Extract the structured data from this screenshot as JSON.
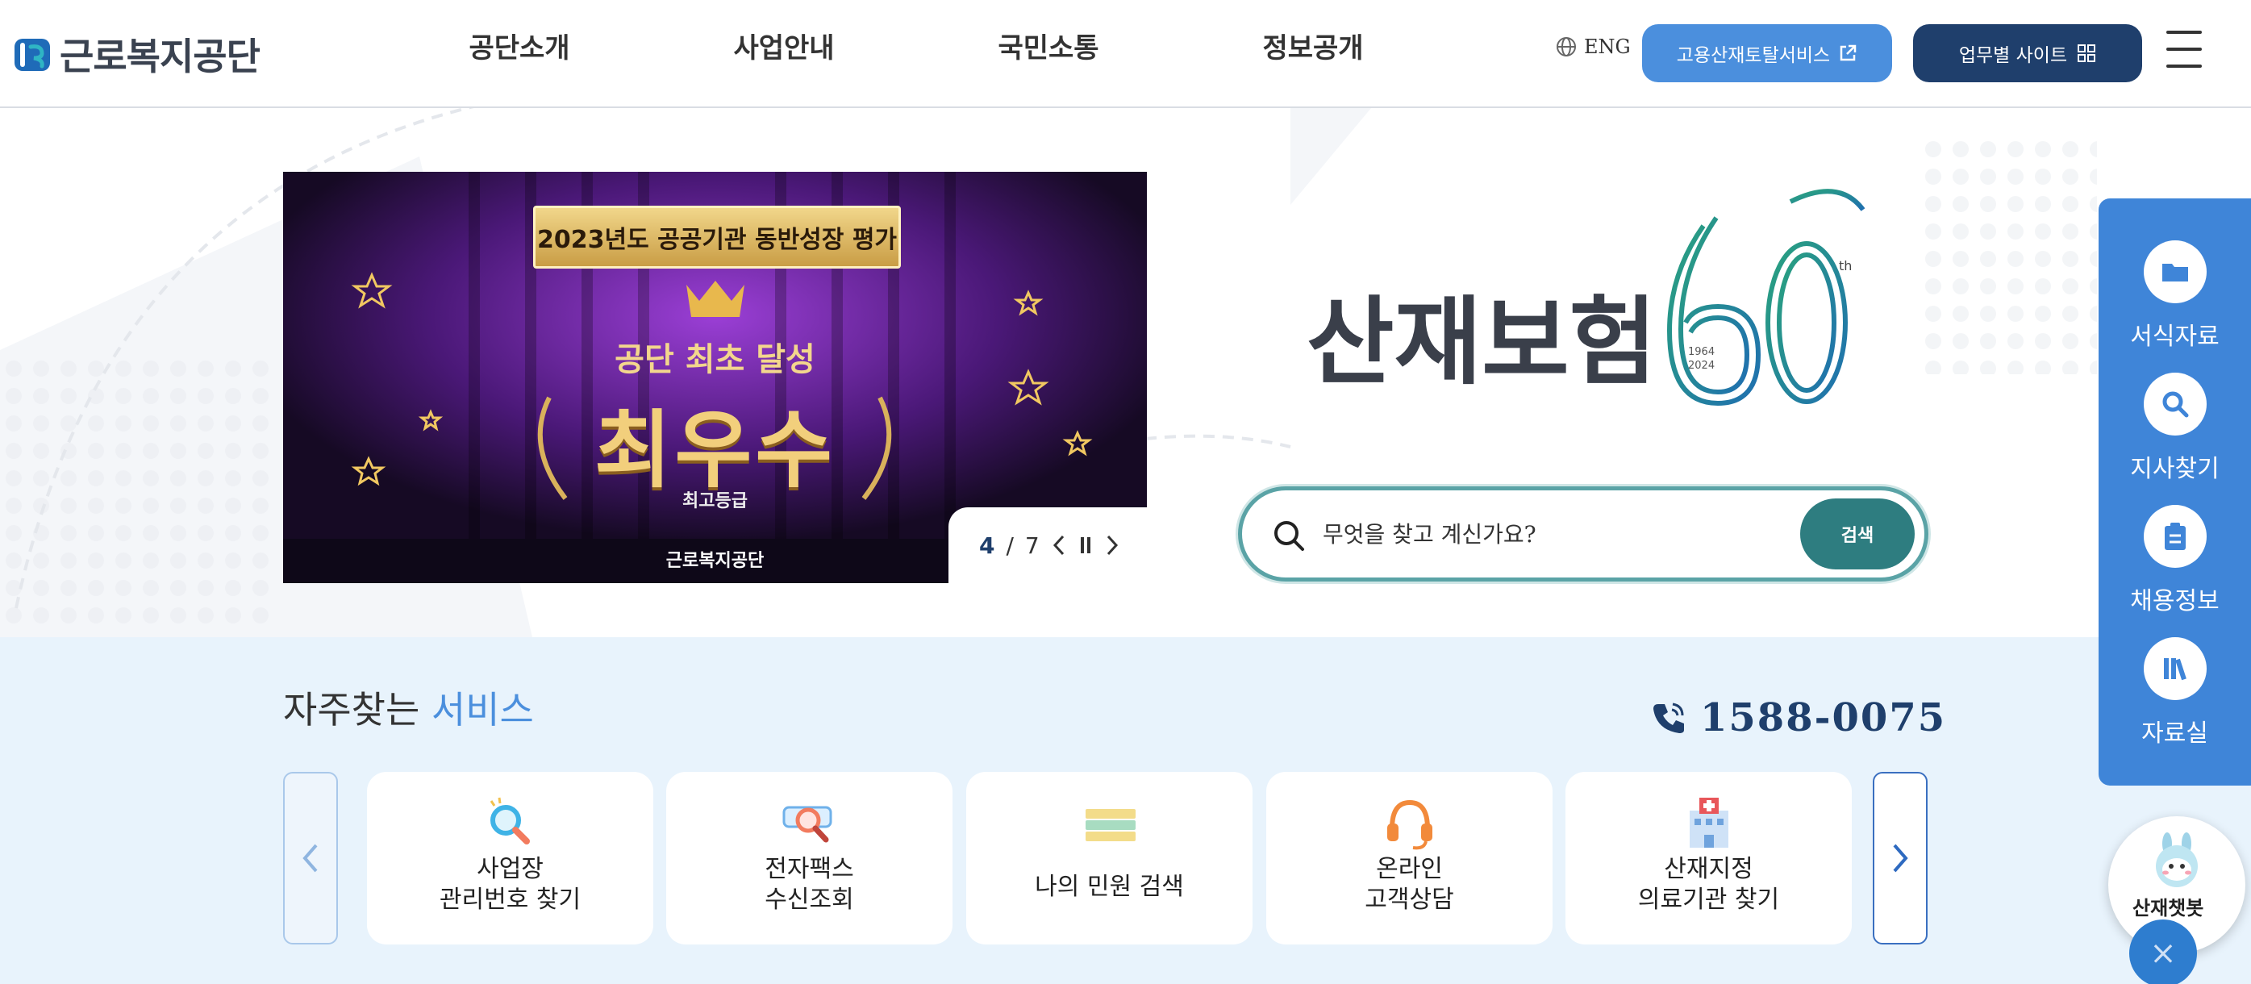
{
  "header": {
    "logo_text": "근로복지공단",
    "nav": [
      "공단소개",
      "사업안내",
      "국민소통",
      "정보공개"
    ],
    "lang_label": "ENG",
    "portal_button": "고용산재토탈서비스",
    "sites_button": "업무별 사이트"
  },
  "hero": {
    "banner": {
      "badge": "2023년도 공공기관 동반성장 평가",
      "subtitle": "공단 최초 달성",
      "main": "최우수",
      "grade": "최고등급",
      "org": "근로복지공단"
    },
    "pager": {
      "current": "4",
      "separator": "/",
      "total": "7"
    },
    "anniversary": {
      "text": "산재보험",
      "number": "60",
      "suffix": "th",
      "years_top": "1964",
      "years_bottom": "2024"
    },
    "search": {
      "placeholder": "무엇을 찾고 계신가요?",
      "button": "검색"
    }
  },
  "quick_menu": {
    "items": [
      {
        "label": "서식자료",
        "icon": "folder-icon"
      },
      {
        "label": "지사찾기",
        "icon": "search-icon"
      },
      {
        "label": "채용정보",
        "icon": "document-icon"
      },
      {
        "label": "자료실",
        "icon": "books-icon"
      }
    ]
  },
  "chatbot": {
    "label": "산재챗봇",
    "close": "×"
  },
  "services": {
    "title_prefix": "자주찾는",
    "title_accent": "서비스",
    "phone": "1588-0075",
    "cards": [
      {
        "label": "사업장\n관리번호 찾기",
        "icon": "magnifier-icon"
      },
      {
        "label": "전자팩스\n수신조회",
        "icon": "fax-icon"
      },
      {
        "label": "나의 민원 검색",
        "icon": "books-stack-icon"
      },
      {
        "label": "온라인\n고객상담",
        "icon": "headset-icon"
      },
      {
        "label": "산재지정\n의료기관 찾기",
        "icon": "hospital-icon"
      }
    ]
  },
  "colors": {
    "accent_blue": "#4b8fdd",
    "navy": "#1f3f6c",
    "teal": "#2e7d80",
    "services_bg": "#e8f3fc"
  }
}
